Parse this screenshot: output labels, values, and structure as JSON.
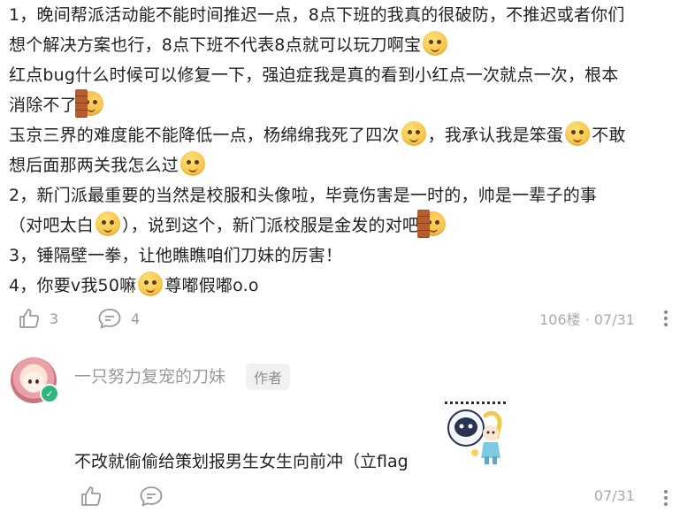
{
  "post": {
    "lines": [
      {
        "parts": [
          "1，晚间帮派活动能不能时间推迟一点，8点下班的我真的很破防，不推迟或者你们"
        ]
      },
      {
        "parts": [
          "想个解决方案也行，8点下班不代表8点就可以玩刀啊宝"
        ],
        "emoji_end": "dizzy-face-emoji"
      },
      {
        "parts": [
          "红点bug什么时候可以修复一下，强迫症我是真的看到小红点一次就点一次，根本"
        ]
      },
      {
        "parts": [
          "消除不了"
        ],
        "emoji_end": "wall-peek-emoji"
      },
      {
        "parts": [
          "玉京三界的难度能不能降低一点，杨绵绵我死了四次",
          "，我承认我是笨蛋",
          "不敢"
        ]
      },
      {
        "parts": [
          "想后面那两关我怎么过"
        ],
        "emoji_end": "relieved-face-emoji"
      },
      {
        "parts": [
          "2，新门派最重要的当然是校服和头像啦，毕竟伤害是一时的，帅是一辈子的事"
        ]
      },
      {
        "parts": [
          "（对吧太白",
          "），说到这个，新门派校服是金发的对吧"
        ]
      },
      {
        "parts": [
          "3，锤隔壁一拳，让他瞧瞧咱们刀妹的厉害！"
        ]
      },
      {
        "parts": [
          "4，你要v我50嘛",
          "尊嘟假嘟o.o"
        ]
      }
    ]
  },
  "post_actions": {
    "like_count": "3",
    "comment_count": "4",
    "floor_date": "106楼 · 07/31"
  },
  "reply": {
    "author_name": "一只努力复宠的刀妹",
    "author_tag": "作者",
    "text": "不改就偷偷给策划报男生女生向前冲（立flag",
    "date": "07/31"
  },
  "colors": {
    "muted_text": "#999999",
    "verify_badge": "#2fb57e",
    "tag_bg": "#f1f1f1"
  }
}
